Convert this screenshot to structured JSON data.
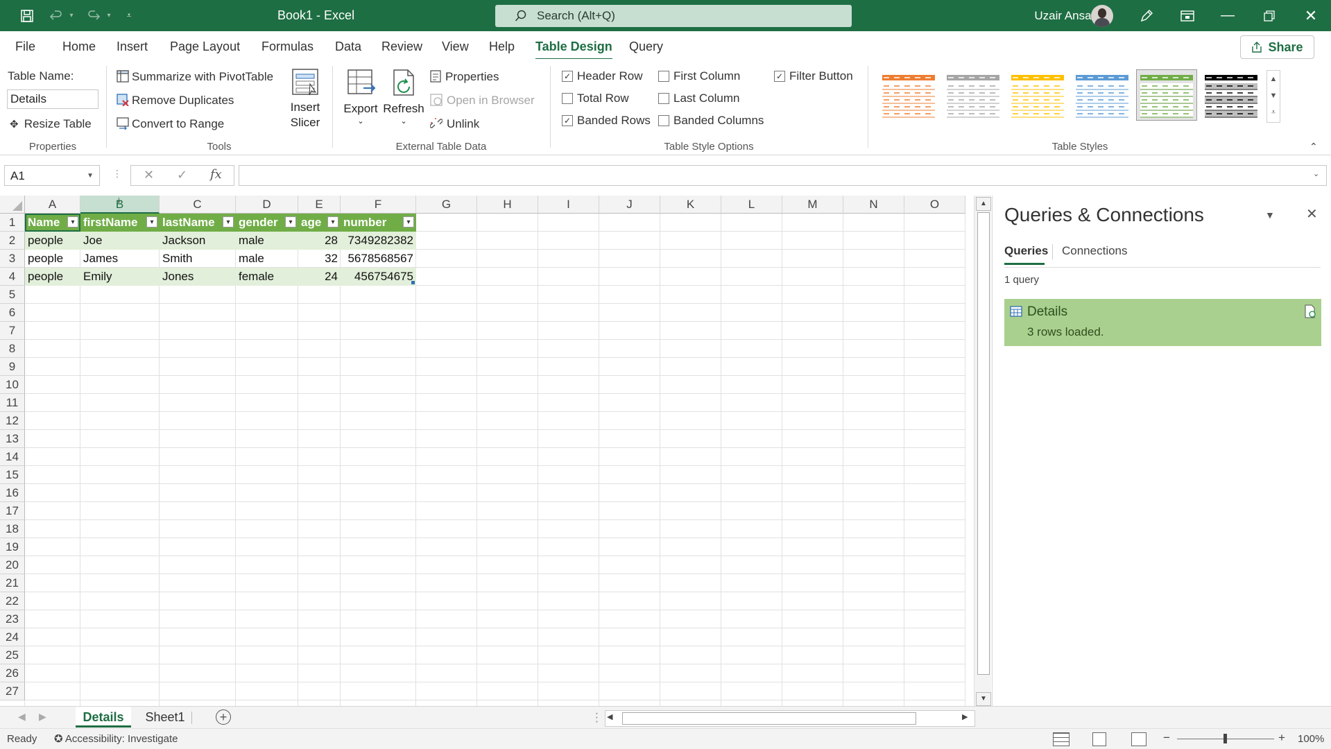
{
  "app": {
    "document": "Book1",
    "sep": " - ",
    "name": "Excel",
    "user": "Uzair Ansari"
  },
  "search": {
    "placeholder": "Search (Alt+Q)"
  },
  "menu": {
    "tabs": [
      "File",
      "Home",
      "Insert",
      "Page Layout",
      "Formulas",
      "Data",
      "Review",
      "View",
      "Help",
      "Table Design",
      "Query"
    ],
    "active": "Table Design",
    "share": "Share"
  },
  "ribbon": {
    "properties": {
      "table_name_label": "Table Name:",
      "table_name_value": "Details",
      "resize": "Resize Table",
      "group": "Properties"
    },
    "tools": {
      "pivot": "Summarize with PivotTable",
      "dupes": "Remove Duplicates",
      "convert": "Convert to Range",
      "slicer_l1": "Insert",
      "slicer_l2": "Slicer",
      "group": "Tools"
    },
    "external": {
      "export": "Export",
      "refresh": "Refresh",
      "properties": "Properties",
      "open_browser": "Open in Browser",
      "unlink": "Unlink",
      "group": "External Table Data"
    },
    "style_options": {
      "header_row": "Header Row",
      "total_row": "Total Row",
      "banded_rows": "Banded Rows",
      "first_column": "First Column",
      "last_column": "Last Column",
      "banded_columns": "Banded Columns",
      "filter_button": "Filter Button",
      "group": "Table Style Options",
      "checked": {
        "header_row": true,
        "total_row": false,
        "banded_rows": true,
        "first_column": false,
        "last_column": false,
        "banded_columns": false,
        "filter_button": true
      }
    },
    "table_styles": {
      "group": "Table Styles",
      "colors": [
        "#ed7d31",
        "#a5a5a5",
        "#ffc000",
        "#5b9bd5",
        "#70ad47",
        "#000000"
      ],
      "selected_index": 4
    }
  },
  "formula_bar": {
    "name_box": "A1",
    "value": ""
  },
  "sheet": {
    "columns": [
      "A",
      "B",
      "C",
      "D",
      "E",
      "F",
      "G",
      "H",
      "I",
      "J",
      "K",
      "L",
      "M",
      "N",
      "O"
    ],
    "selected_column": "B",
    "rows": [
      "1",
      "2",
      "3",
      "4",
      "5",
      "6",
      "7",
      "8",
      "9",
      "10",
      "11",
      "12",
      "13",
      "14",
      "15",
      "16",
      "17",
      "18",
      "19",
      "20",
      "21",
      "22",
      "23",
      "24",
      "25",
      "26",
      "27"
    ],
    "headers": [
      "Name",
      "firstName",
      "lastName",
      "gender",
      "age",
      "number"
    ],
    "data": [
      [
        "people",
        "Joe",
        "Jackson",
        "male",
        "28",
        "7349282382"
      ],
      [
        "people",
        "James",
        "Smith",
        "male",
        "32",
        "5678568567"
      ],
      [
        "people",
        "Emily",
        "Jones",
        "female",
        "24",
        "456754675"
      ]
    ]
  },
  "pane": {
    "title": "Queries & Connections",
    "tabs": [
      "Queries",
      "Connections"
    ],
    "count": "1 query",
    "query": {
      "name": "Details",
      "status": "3 rows loaded."
    }
  },
  "sheets": {
    "tabs": [
      "Details",
      "Sheet1"
    ],
    "active": "Details"
  },
  "status": {
    "ready": "Ready",
    "accessibility": "Accessibility: Investigate",
    "zoom": "100%"
  }
}
